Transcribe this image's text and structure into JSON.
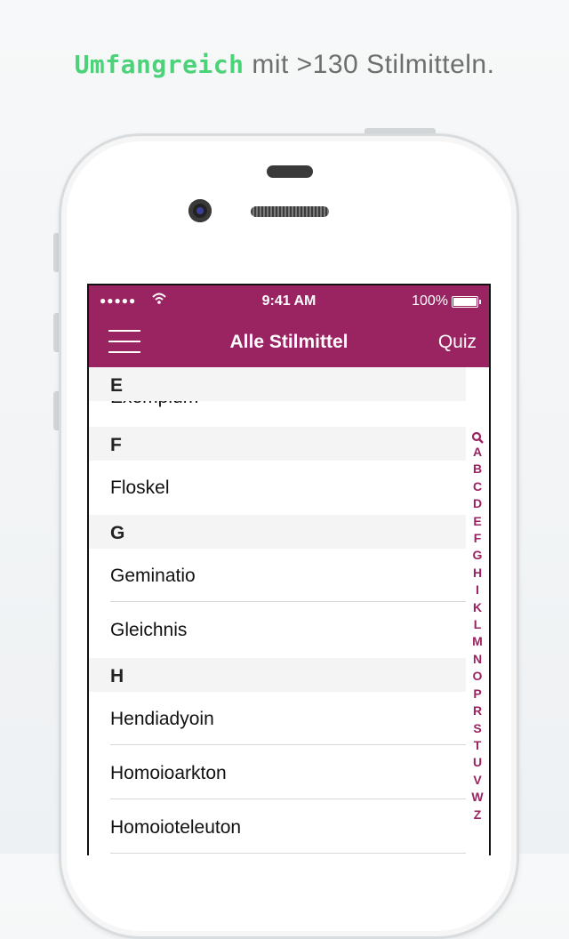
{
  "headline": {
    "strong": "Umfangreich",
    "rest": " mit >130 Stilmitteln."
  },
  "statusbar": {
    "signal": "●●●●●",
    "time": "9:41 AM",
    "battery": "100%"
  },
  "navbar": {
    "title": "Alle Stilmittel",
    "quiz": "Quiz"
  },
  "sections": {
    "e": {
      "letter": "E",
      "items": [
        "Exemplum"
      ]
    },
    "f": {
      "letter": "F",
      "items": [
        "Floskel"
      ]
    },
    "g": {
      "letter": "G",
      "items": [
        "Geminatio",
        "Gleichnis"
      ]
    },
    "h": {
      "letter": "H",
      "items": [
        "Hendiadyoin",
        "Homoioarkton",
        "Homoioteleuton"
      ]
    }
  },
  "index_letters": [
    "A",
    "B",
    "C",
    "D",
    "E",
    "F",
    "G",
    "H",
    "I",
    "K",
    "L",
    "M",
    "N",
    "O",
    "P",
    "R",
    "S",
    "T",
    "U",
    "V",
    "W",
    "Z"
  ],
  "colors": {
    "accent": "#9a2361",
    "headline_green": "#4cd37a"
  }
}
